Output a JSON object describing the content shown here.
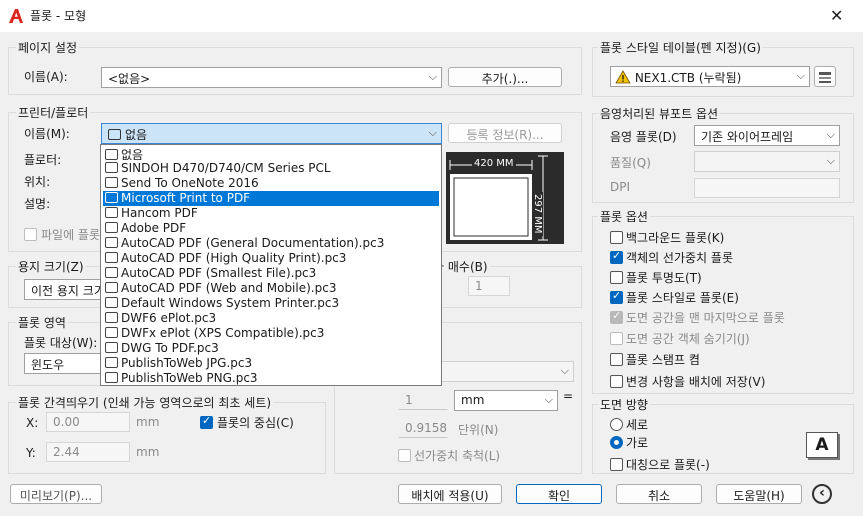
{
  "window": {
    "title": "플롯 - 모형",
    "close_glyph": "✕"
  },
  "page_setup": {
    "group_label": "페이지 설정",
    "name_label": "이름(A):",
    "name_value": "<없음>",
    "add_button": "추가(.)..."
  },
  "printer": {
    "group_label": "프린터/플로터",
    "name_label": "이름(M):",
    "name_value": "없음",
    "properties_button": "등록 정보(R)...",
    "plotter_label": "플로터:",
    "location_label": "위치:",
    "description_label": "설명:",
    "plot_to_file_label": "파일에 플롯",
    "options": [
      "없음",
      "SINDOH D470/D740/CM Series PCL",
      "Send To OneNote 2016",
      "Microsoft Print to PDF",
      "Hancom PDF",
      "Adobe PDF",
      "AutoCAD PDF (General Documentation).pc3",
      "AutoCAD PDF (High Quality Print).pc3",
      "AutoCAD PDF (Smallest File).pc3",
      "AutoCAD PDF (Web and Mobile).pc3",
      "Default Windows System Printer.pc3",
      "DWF6 ePlot.pc3",
      "DWFx ePlot (XPS Compatible).pc3",
      "DWG To PDF.pc3",
      "PublishToWeb JPG.pc3",
      "PublishToWeb PNG.pc3"
    ],
    "selected_index": 3,
    "preview_width": "420 MM",
    "preview_height": "297 MM"
  },
  "paper_size": {
    "group_label": "용지 크기(Z)",
    "value": "이전 용지 크기"
  },
  "copies": {
    "label": "복사 매수(B)",
    "value": "1"
  },
  "plot_area": {
    "group_label": "플롯 영역",
    "what_label": "플롯 대상(W):",
    "what_value": "윈도우"
  },
  "plot_offset": {
    "group_label": "플롯 간격띄우기 (인쇄 가능 영역으로의 최초 세트)",
    "x_label": "X:",
    "x_value": "0.00",
    "x_unit": "mm",
    "y_label": "Y:",
    "y_value": "2.44",
    "y_unit": "mm",
    "center_label": "플롯의 중심(C)"
  },
  "plot_scale": {
    "value1": "1",
    "unit": "mm",
    "equals": "=",
    "value2": "0.9158",
    "unit2_label": "단위(N)",
    "scale_lineweights_label": "선가중치 축척(L)"
  },
  "plot_style_table": {
    "group_label": "플롯 스타일 테이블(펜 지정)(G)",
    "value": "NEX1.CTB (누락됨)"
  },
  "shaded_viewport": {
    "group_label": "음영처리된 뷰포트 옵션",
    "shade_label": "음영 플롯(D)",
    "shade_value": "기존 와이어프레임",
    "quality_label": "품질(Q)",
    "dpi_label": "DPI"
  },
  "plot_options": {
    "group_label": "플롯 옵션",
    "items": [
      {
        "label": "백그라운드 플롯(K)",
        "checked": false,
        "enabled": true
      },
      {
        "label": "객체의 선가중치 플롯",
        "checked": true,
        "enabled": true
      },
      {
        "label": "플롯 투명도(T)",
        "checked": false,
        "enabled": true
      },
      {
        "label": "플롯 스타일로 플롯(E)",
        "checked": true,
        "enabled": true
      },
      {
        "label": "도면 공간을 맨 마지막으로 플롯",
        "checked": true,
        "enabled": false
      },
      {
        "label": "도면 공간 객체 숨기기(J)",
        "checked": false,
        "enabled": false
      },
      {
        "label": "플롯 스탬프 켬",
        "checked": false,
        "enabled": true
      },
      {
        "label": "변경 사항을 배치에 저장(V)",
        "checked": false,
        "enabled": true
      }
    ]
  },
  "orientation": {
    "group_label": "도면 방향",
    "portrait_label": "세로",
    "landscape_label": "가로",
    "upside_down_label": "대칭으로 플롯(-)",
    "selected": "가로",
    "icon_letter": "A"
  },
  "footer": {
    "preview_button": "미리보기(P)...",
    "apply_button": "배치에 적용(U)",
    "ok_button": "확인",
    "cancel_button": "취소",
    "help_button": "도움말(H)",
    "collapse_glyph": "‹"
  },
  "colors": {
    "accent": "#0067c0",
    "selection": "#0078d7",
    "app_icon": "#d9281e"
  }
}
